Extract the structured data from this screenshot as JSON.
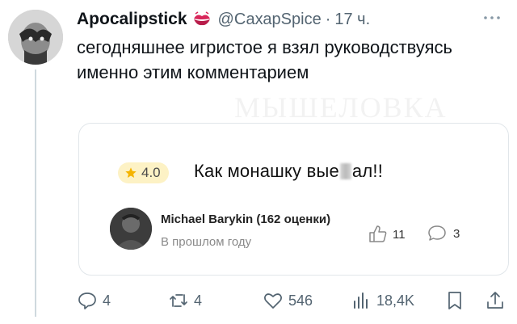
{
  "tweet": {
    "display_name": "Apocalipstick",
    "name_emoji_icon": "kiss-lips-icon",
    "handle": "@СахарSpice",
    "separator": "·",
    "time": "17 ч.",
    "text": "сегодняшнее игристое я взял руководствуясь именно этим комментарием",
    "watermark": "МЫШЕЛОВКА"
  },
  "card": {
    "rating": "4.0",
    "review_text_before": "Как монашку вые",
    "review_text_after": "ал!!",
    "reviewer_name": "Michael Barykin (162 оценки)",
    "review_date": "В прошлом году",
    "likes": "11",
    "comments": "3",
    "colors": {
      "rating_badge_bg": "#fdf2c5",
      "star": "#f5b400"
    }
  },
  "actions": {
    "replies": "4",
    "retweets": "4",
    "likes": "546",
    "views": "18,4K",
    "icons": [
      "reply-icon",
      "retweet-icon",
      "like-icon",
      "views-icon",
      "bookmark-icon",
      "share-icon"
    ]
  },
  "colors": {
    "text": "#0f1419",
    "secondary": "#536471",
    "lips": "#d8265a"
  }
}
